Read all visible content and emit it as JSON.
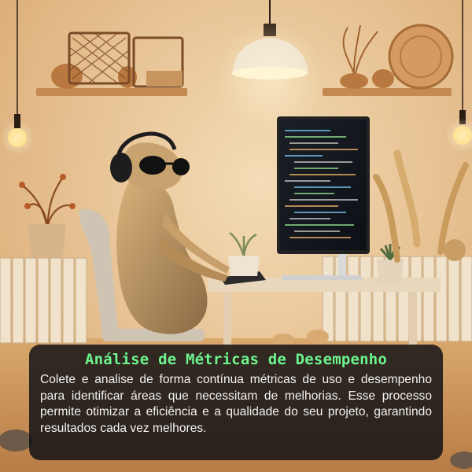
{
  "card": {
    "title": "Análise de Métricas de Desempenho",
    "body": "Colete e analise de forma contínua métricas de uso e desempenho para identificar áreas que necessitam de melhorias. Esse processo permite otimizar a eficiência e a qualidade do seu projeto, garantindo resultados cada vez melhores."
  },
  "colors": {
    "title": "#6ef58e",
    "card_background": "#0c0e12",
    "wall": "#e8c496"
  },
  "icons": {
    "scene": "meerkat-at-computer-illustration"
  }
}
